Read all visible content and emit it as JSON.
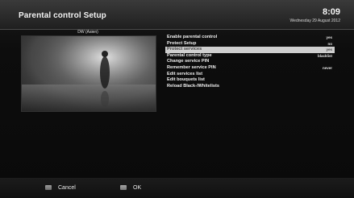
{
  "header": {
    "title": "Parental control Setup",
    "time": "8:09",
    "date": "Wednesday 29 August 2012"
  },
  "preview": {
    "channel": "DW (Asien)"
  },
  "menu": {
    "items": [
      {
        "label": "Enable parental control",
        "value": "yes",
        "selected": false
      },
      {
        "label": "Protect Setup",
        "value": "no",
        "selected": false
      },
      {
        "label": "Protect services",
        "value": "yes",
        "selected": true
      },
      {
        "label": "Parental control type",
        "value": "blacklist",
        "selected": false
      },
      {
        "label": "Change service PIN",
        "value": "",
        "selected": false
      },
      {
        "label": "Remember service PIN",
        "value": "never",
        "selected": false
      },
      {
        "label": "Edit services list",
        "value": "",
        "selected": false
      },
      {
        "label": "Edit bouquets list",
        "value": "",
        "selected": false
      },
      {
        "label": "Reload Black-/Whitelists",
        "value": "",
        "selected": false
      }
    ]
  },
  "footer": {
    "cancel_label": "Cancel",
    "ok_label": "OK"
  },
  "colors": {
    "selection": "#cfcfcf",
    "background": "#0b0b0b"
  }
}
